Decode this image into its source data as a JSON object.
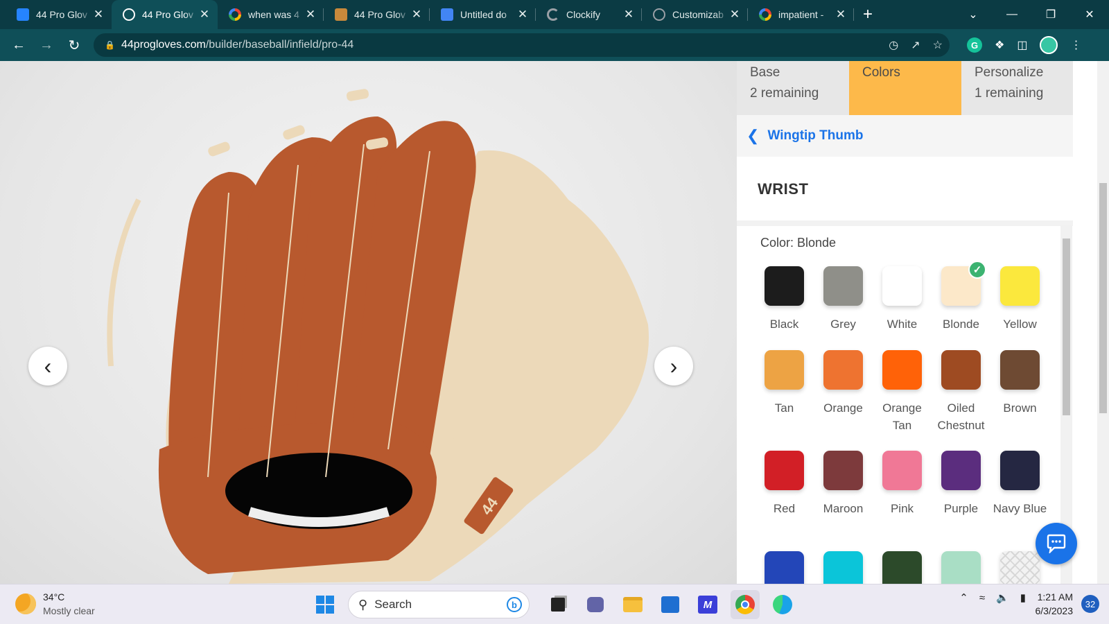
{
  "browser": {
    "tabs": [
      {
        "title": "44 Pro Glov",
        "favicon": "trello-icon",
        "color": "#2684ff",
        "active": false
      },
      {
        "title": "44 Pro Glov",
        "favicon": "globe-icon",
        "color": "#ffffff",
        "active": true
      },
      {
        "title": "when was 4",
        "favicon": "google-icon",
        "color": "#ffffff",
        "active": false
      },
      {
        "title": "44 Pro Glov",
        "favicon": "glove-icon",
        "color": "#c8893b",
        "active": false
      },
      {
        "title": "Untitled do",
        "favicon": "docs-icon",
        "color": "#4285f4",
        "active": false
      },
      {
        "title": "Clockify",
        "favicon": "clockify-icon",
        "color": "#9aa0a6",
        "active": false
      },
      {
        "title": "Customizab",
        "favicon": "openai-icon",
        "color": "#9aa0a6",
        "active": false
      },
      {
        "title": "impatient -",
        "favicon": "google-icon",
        "color": "#ffffff",
        "active": false
      }
    ],
    "url_host": "44progloves.com",
    "url_path": "/builder/baseball/infield/pro-44"
  },
  "builder": {
    "steps": [
      {
        "label": "Base",
        "sub": "2 remaining",
        "active": false
      },
      {
        "label": "Colors",
        "sub": "",
        "active": true
      },
      {
        "label": "Personalize",
        "sub": "1 remaining",
        "active": false
      }
    ],
    "back_label": "Wingtip Thumb",
    "section_title": "WRIST",
    "color_label": "Color: Blonde",
    "selected": "Blonde",
    "swatches": [
      {
        "name": "Black",
        "color": "#1c1c1c"
      },
      {
        "name": "Grey",
        "color": "#8f8f89"
      },
      {
        "name": "White",
        "color": "#ffffff"
      },
      {
        "name": "Blonde",
        "color": "#fce8c9"
      },
      {
        "name": "Yellow",
        "color": "#fbe83d"
      },
      {
        "name": "Tan",
        "color": "#eda344"
      },
      {
        "name": "Orange",
        "color": "#ee7330"
      },
      {
        "name": "Orange Tan",
        "color": "#ff6208"
      },
      {
        "name": "Oiled Chestnut",
        "color": "#9e4b22"
      },
      {
        "name": "Brown",
        "color": "#6e4a33"
      },
      {
        "name": "Red",
        "color": "#d21f26"
      },
      {
        "name": "Maroon",
        "color": "#7d3a3c"
      },
      {
        "name": "Pink",
        "color": "#f07896"
      },
      {
        "name": "Purple",
        "color": "#5b2d7e"
      },
      {
        "name": "Navy Blue",
        "color": "#252742"
      },
      {
        "name": "",
        "color": "#2346b8"
      },
      {
        "name": "",
        "color": "#0bc5d9"
      },
      {
        "name": "",
        "color": "#2c4a2a"
      },
      {
        "name": "",
        "color": "#a9dec5"
      },
      {
        "name": "",
        "color": "pattern"
      }
    ]
  },
  "glove": {
    "shell_color": "#b8592e",
    "blonde_color": "#ecd9b9",
    "logo_text": "44"
  },
  "taskbar": {
    "temperature": "34°C",
    "weather": "Mostly clear",
    "search_placeholder": "Search",
    "time": "1:21 AM",
    "date": "6/3/2023",
    "notification_count": "32"
  }
}
